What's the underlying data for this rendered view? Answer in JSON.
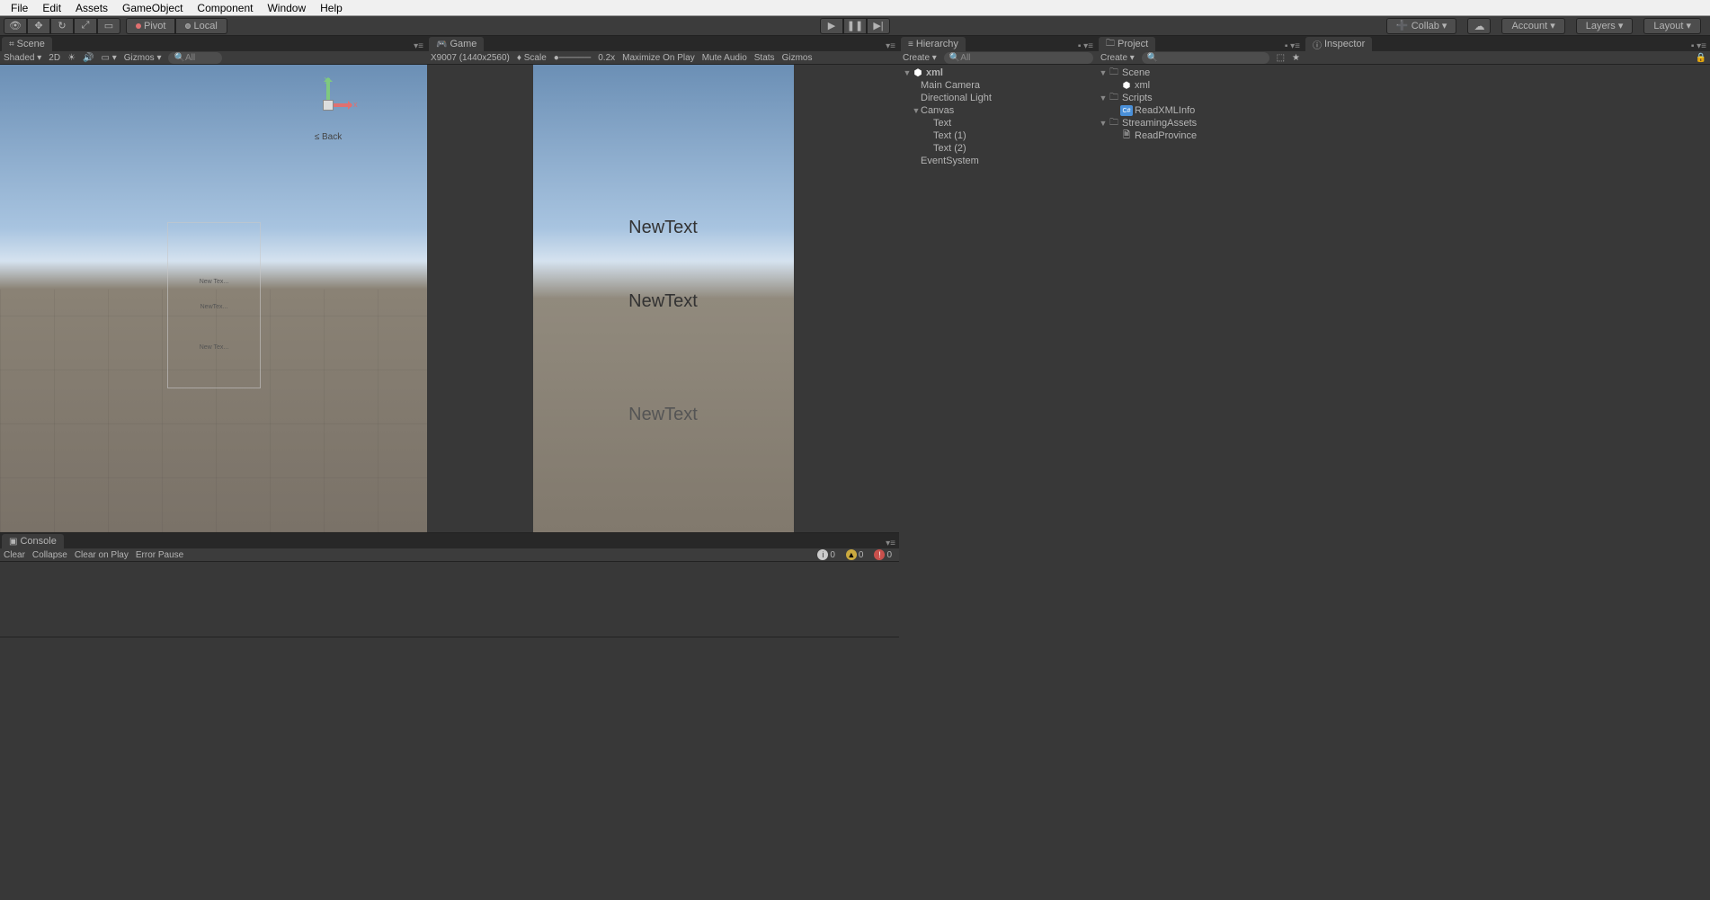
{
  "menubar": [
    "File",
    "Edit",
    "Assets",
    "GameObject",
    "Component",
    "Window",
    "Help"
  ],
  "toolbar": {
    "pivot": "Pivot",
    "local": "Local",
    "collab": "Collab",
    "account": "Account",
    "layers": "Layers",
    "layout": "Layout"
  },
  "scene": {
    "tab": "Scene",
    "shading": "Shaded",
    "mode2d": "2D",
    "gizmos": "Gizmos",
    "search_placeholder": "All",
    "gizmo_back": "≤ Back",
    "mini_texts": [
      "New Tex...",
      "NewTex...",
      "New Tex..."
    ]
  },
  "game": {
    "tab": "Game",
    "resolution": "X9007 (1440x2560)",
    "scale_label": "Scale",
    "scale_value": "0.2x",
    "maximize": "Maximize On Play",
    "mute": "Mute Audio",
    "stats": "Stats",
    "gizmos": "Gizmos",
    "texts": [
      "NewText",
      "NewText",
      "NewText"
    ]
  },
  "hierarchy": {
    "tab": "Hierarchy",
    "create": "Create",
    "search_placeholder": "All",
    "scene_name": "xml",
    "items": [
      {
        "label": "Main Camera",
        "indent": 1
      },
      {
        "label": "Directional Light",
        "indent": 1
      },
      {
        "label": "Canvas",
        "indent": 1,
        "expandable": true,
        "expanded": true
      },
      {
        "label": "Text",
        "indent": 2
      },
      {
        "label": "Text (1)",
        "indent": 2
      },
      {
        "label": "Text (2)",
        "indent": 2
      },
      {
        "label": "EventSystem",
        "indent": 1
      }
    ]
  },
  "project": {
    "tab": "Project",
    "create": "Create",
    "items": [
      {
        "label": "Scene",
        "indent": 0,
        "icon": "folder",
        "expandable": true,
        "expanded": true
      },
      {
        "label": "xml",
        "indent": 1,
        "icon": "unity"
      },
      {
        "label": "Scripts",
        "indent": 0,
        "icon": "folder",
        "expandable": true,
        "expanded": true
      },
      {
        "label": "ReadXMLInfo",
        "indent": 1,
        "icon": "cs"
      },
      {
        "label": "StreamingAssets",
        "indent": 0,
        "icon": "folder",
        "expandable": true,
        "expanded": true
      },
      {
        "label": "ReadProvince",
        "indent": 1,
        "icon": "file"
      }
    ]
  },
  "inspector": {
    "tab": "Inspector"
  },
  "console": {
    "tab": "Console",
    "clear": "Clear",
    "collapse": "Collapse",
    "clear_on_play": "Clear on Play",
    "error_pause": "Error Pause",
    "info_count": "0",
    "warn_count": "0",
    "err_count": "0"
  }
}
